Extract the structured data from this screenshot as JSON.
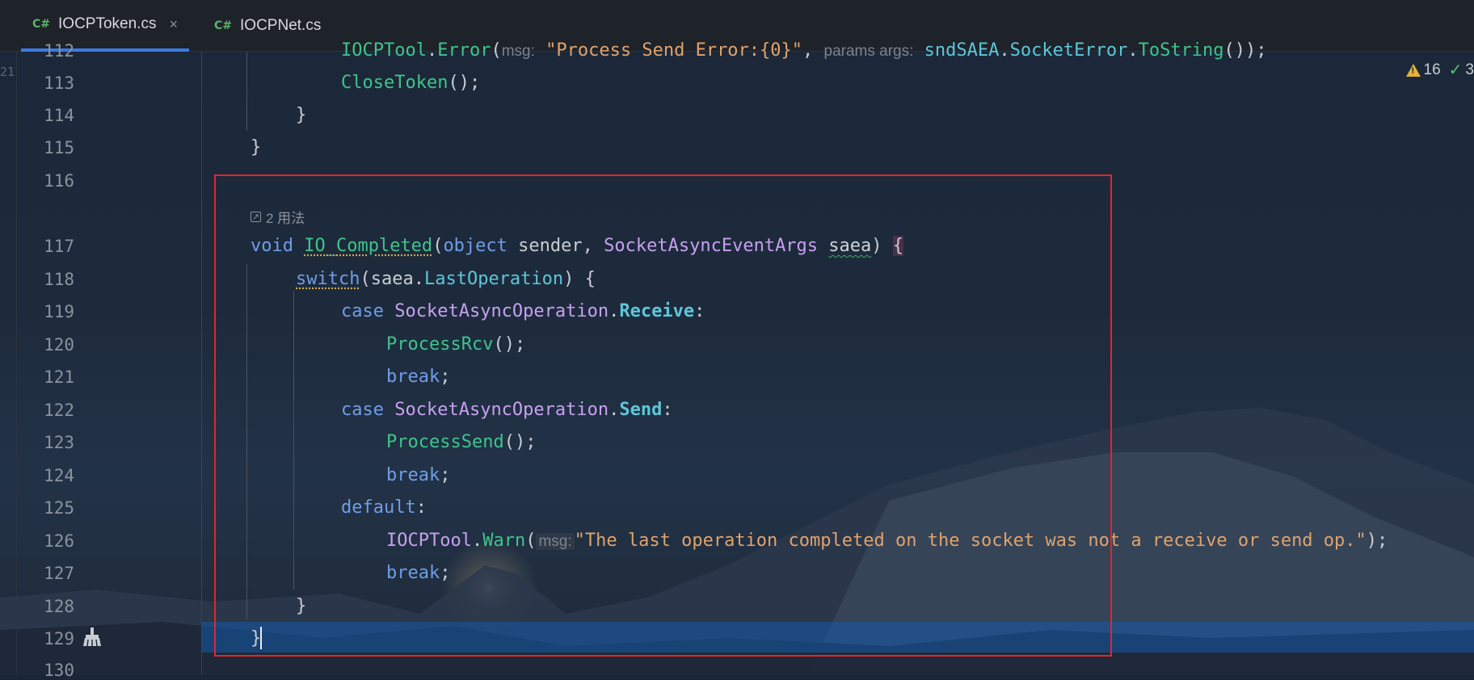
{
  "tabs": [
    {
      "lang": "C#",
      "label": "IOCPToken.cs",
      "close": "×",
      "active": true
    },
    {
      "lang": "C#",
      "label": "IOCPNet.cs",
      "active": false
    }
  ],
  "gutter_prev": "21",
  "status": {
    "warnings": "16",
    "checks": "3"
  },
  "usages": "2 用法",
  "lines": {
    "l112": "112",
    "l113": "113",
    "l114": "114",
    "l115": "115",
    "l116": "116",
    "l117": "117",
    "l118": "118",
    "l119": "119",
    "l120": "120",
    "l121": "121",
    "l122": "122",
    "l123": "123",
    "l124": "124",
    "l125": "125",
    "l126": "126",
    "l127": "127",
    "l128": "128",
    "l129": "129",
    "l130": "130"
  },
  "code": {
    "l112": {
      "a": "IOCPTool",
      "b": ".",
      "c": "Error",
      "d": "(",
      "hint": "msg:",
      "s": "\"Process Send Error:{0}\"",
      "e": ",",
      "hint2": "params args:",
      "f": "sndSAEA",
      "g": ".",
      "h": "SocketError",
      "i": ".",
      "j": "ToString",
      "k": "());"
    },
    "l113": {
      "fn": "CloseToken",
      "rest": "();"
    },
    "l114": "}",
    "l115": "}",
    "l117": {
      "kw": "void",
      "fn": "IO_Completed",
      "p1": "(",
      "kw2": "object",
      "p2": " sender, ",
      "typ": "SocketAsyncEventArgs",
      "p3": " ",
      "param": "saea",
      "p4": ") ",
      "brace": "{"
    },
    "l118": {
      "kw": "switch",
      "p1": "(saea.",
      "mem": "LastOperation",
      "p2": ") {"
    },
    "l119": {
      "kw": "case",
      "typ": "SocketAsyncOperation",
      "dot": ".",
      "mem": "Receive",
      "colon": ":"
    },
    "l120": {
      "fn": "ProcessRcv",
      "rest": "();"
    },
    "l121": {
      "kw": "break",
      "rest": ";"
    },
    "l122": {
      "kw": "case",
      "typ": "SocketAsyncOperation",
      "dot": ".",
      "mem": "Send",
      "colon": ":"
    },
    "l123": {
      "fn": "ProcessSend",
      "rest": "();"
    },
    "l124": {
      "kw": "break",
      "rest": ";"
    },
    "l125": {
      "kw": "default",
      "rest": ":"
    },
    "l126": {
      "typ": "IOCPTool",
      "dot": ".",
      "fn": "Warn",
      "p1": "(",
      "hint": "msg:",
      "str": "\"The last operation completed on the socket was not a receive or send op.\"",
      "p2": ");"
    },
    "l127": {
      "kw": "break",
      "rest": ";"
    },
    "l128": "}",
    "l129": "}"
  },
  "colors": {
    "keyword": "#6f9ee8",
    "type": "#c7a0f0",
    "function": "#3fc48d",
    "member": "#5ec6d9",
    "string": "#e0a36d",
    "highlight_box": "#e0262d",
    "current_line": "#145aaa",
    "tab_underline": "#3b7be0"
  },
  "icons": {
    "warning": "warning-triangle-icon",
    "check": "check-icon",
    "gutter": "broom-icon",
    "usages": "usages-link-icon",
    "file": "csharp-file-icon"
  }
}
